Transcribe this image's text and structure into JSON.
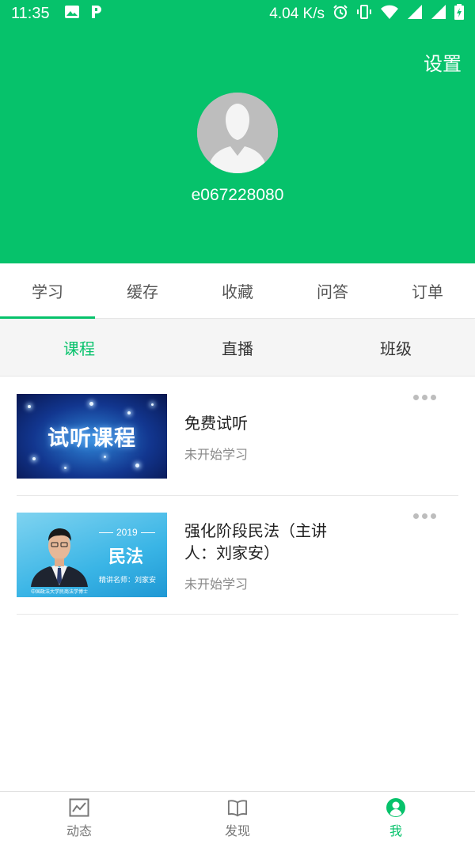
{
  "status_bar": {
    "time": "11:35",
    "net_speed": "4.04 K/s"
  },
  "header": {
    "settings_label": "设置",
    "username": "e067228080"
  },
  "main_tabs": [
    {
      "label": "学习",
      "active": true
    },
    {
      "label": "缓存",
      "active": false
    },
    {
      "label": "收藏",
      "active": false
    },
    {
      "label": "问答",
      "active": false
    },
    {
      "label": "订单",
      "active": false
    }
  ],
  "sub_tabs": [
    {
      "label": "课程",
      "active": true
    },
    {
      "label": "直播",
      "active": false
    },
    {
      "label": "班级",
      "active": false
    }
  ],
  "courses": [
    {
      "title": "免费试听",
      "status": "未开始学习",
      "thumb_text": "试听课程"
    },
    {
      "title": "强化阶段民法（主讲人：刘家安）",
      "status": "未开始学习",
      "thumb_year": "2019",
      "thumb_title": "民法",
      "thumb_teacher": "精讲名师：刘家安",
      "thumb_caption": "中国政法大学民商法学博士"
    }
  ],
  "bottom_nav": [
    {
      "label": "动态",
      "icon": "trend-chart-icon",
      "active": false
    },
    {
      "label": "发现",
      "icon": "open-book-icon",
      "active": false
    },
    {
      "label": "我",
      "icon": "user-circle-icon",
      "active": true
    }
  ],
  "colors": {
    "brand_green": "#06c26b",
    "tab_bg": "#f5f5f5",
    "muted_text": "#888888"
  }
}
